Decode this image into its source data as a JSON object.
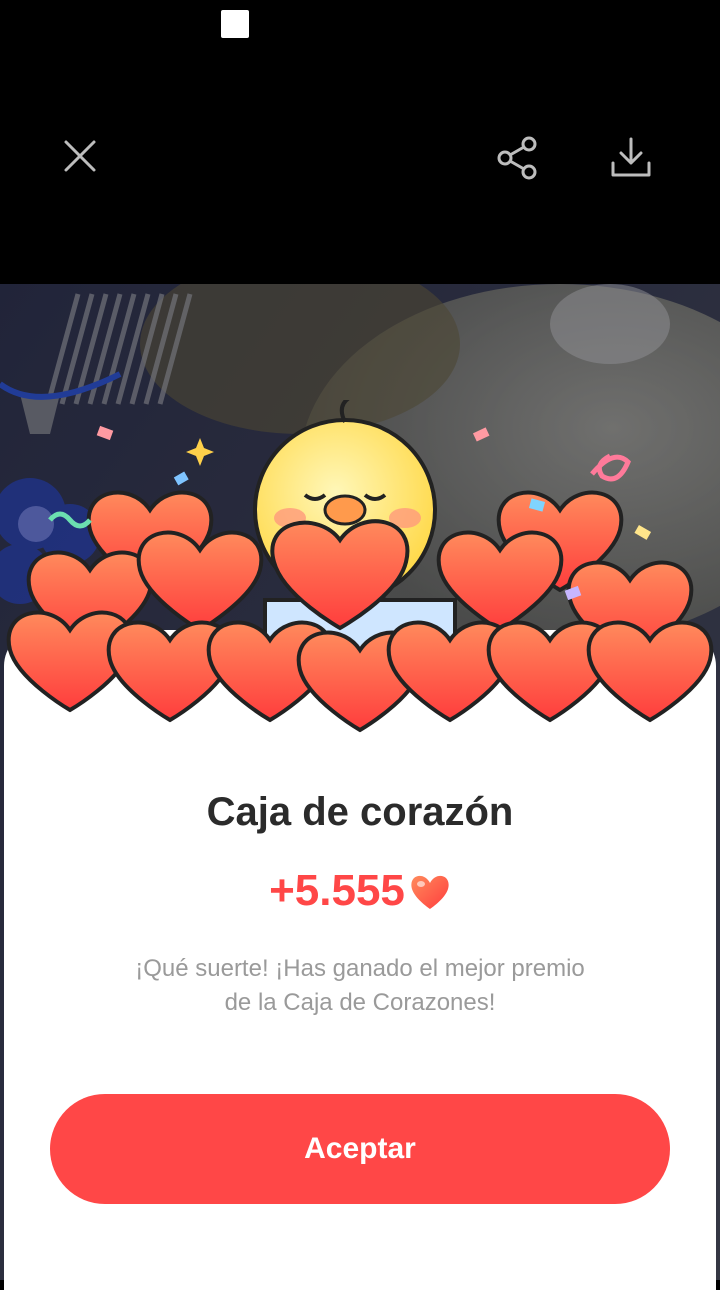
{
  "topbar": {
    "close_icon": "close-icon",
    "share_icon": "share-icon",
    "download_icon": "download-icon"
  },
  "dialog": {
    "title": "Caja de corazón",
    "reward_value": "+5.555",
    "reward_icon": "heart-icon",
    "message": "¡Qué suerte! ¡Has ganado el mejor premio de la Caja de Corazones!",
    "accept_label": "Aceptar"
  },
  "colors": {
    "accent": "#ff4747",
    "title": "#2b2b2b",
    "message": "#9a9a9a"
  }
}
